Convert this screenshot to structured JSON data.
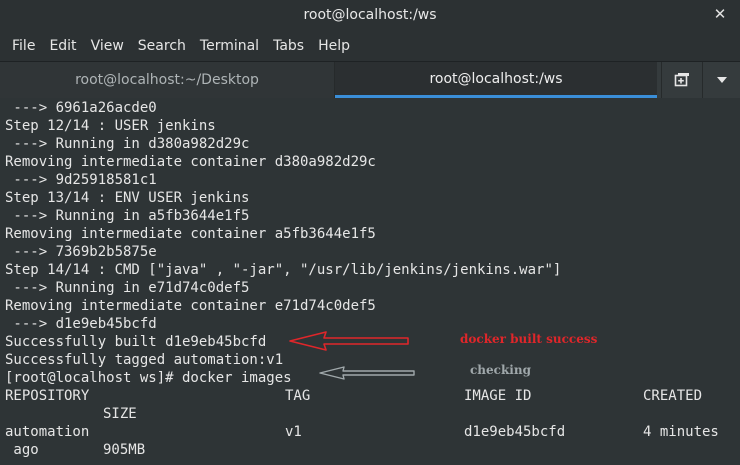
{
  "window": {
    "title": "root@localhost:/ws"
  },
  "menu": [
    "File",
    "Edit",
    "View",
    "Search",
    "Terminal",
    "Tabs",
    "Help"
  ],
  "tabs": [
    {
      "label": "root@localhost:~/Desktop",
      "active": false
    },
    {
      "label": "root@localhost:/ws",
      "active": true
    }
  ],
  "terminal": {
    "lines": [
      " ---> 6961a26acde0",
      "Step 12/14 : USER jenkins",
      " ---> Running in d380a982d29c",
      "Removing intermediate container d380a982d29c",
      " ---> 9d25918581c1",
      "Step 13/14 : ENV USER jenkins",
      " ---> Running in a5fb3644e1f5",
      "Removing intermediate container a5fb3644e1f5",
      " ---> 7369b2b5875e",
      "Step 14/14 : CMD [\"java\" , \"-jar\", \"/usr/lib/jenkins/jenkins.war\"]",
      " ---> Running in e71d74c0def5",
      "Removing intermediate container e71d74c0def5",
      " ---> d1e9eb45bcfd",
      "Successfully built d1e9eb45bcfd",
      "Successfully tagged automation:v1",
      "[root@localhost ws]# docker images"
    ],
    "table": {
      "headers": [
        "REPOSITORY",
        "TAG",
        "IMAGE ID",
        "CREATED"
      ],
      "size_header": "SIZE",
      "rows": [
        {
          "repository": "automation",
          "tag": "v1",
          "image_id": "d1e9eb45bcfd",
          "created": "4 minutes",
          "created_cont": " ago",
          "size": "905MB"
        }
      ]
    }
  },
  "annotations": {
    "built": "docker built success",
    "checking": "checking"
  },
  "colors": {
    "terminal_bg": "#2e3436",
    "terminal_fg": "#e6e6e6",
    "annotation_red": "#e0262a",
    "annotation_gray": "#a0a8ab",
    "active_tab_accent": "#3a8ed8"
  },
  "icons": {
    "close": "close-icon",
    "new_tab": "new-tab-icon",
    "menu": "chevron-down-icon"
  }
}
